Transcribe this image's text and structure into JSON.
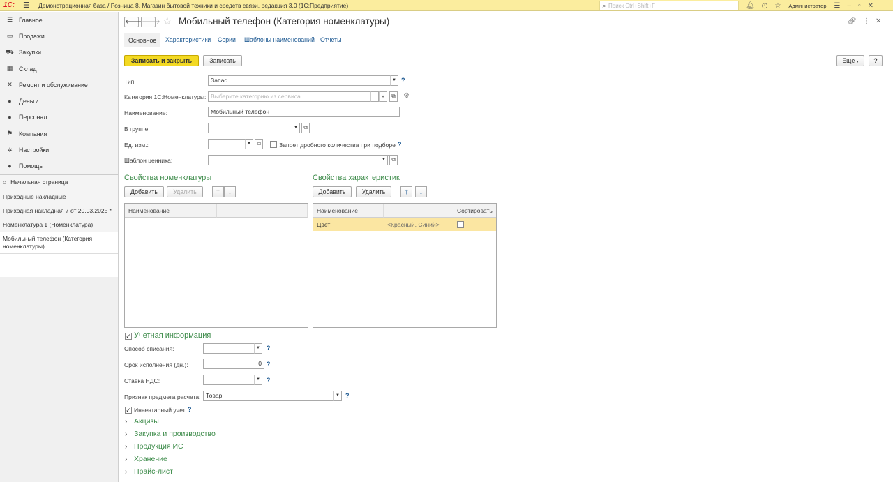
{
  "topbar": {
    "logo": "1С:",
    "title": "Демонстрационная база / Розница 8. Магазин бытовой техники и средств связи, редакция 3.0  (1С:Предприятие)",
    "search_placeholder": "Поиск Ctrl+Shift+F",
    "user": "Администратор"
  },
  "sidebar": {
    "items": [
      {
        "label": "Главное",
        "icon": "menu-icon"
      },
      {
        "label": "Продажи",
        "icon": "sales-icon"
      },
      {
        "label": "Закупки",
        "icon": "purchases-icon"
      },
      {
        "label": "Склад",
        "icon": "warehouse-icon"
      },
      {
        "label": "Ремонт и обслуживание",
        "icon": "repair-icon"
      },
      {
        "label": "Деньги",
        "icon": "money-icon"
      },
      {
        "label": "Персонал",
        "icon": "personnel-icon"
      },
      {
        "label": "Компания",
        "icon": "company-icon"
      },
      {
        "label": "Настройки",
        "icon": "settings-icon"
      },
      {
        "label": "Помощь",
        "icon": "help-icon"
      }
    ],
    "open_windows": {
      "home": "Начальная страница",
      "w1": "Приходные накладные",
      "w2": "Приходная накладная 7 от 20.03.2025 *",
      "w3": "Номенклатура 1 (Номенклатура)",
      "w4": "Мобильный телефон (Категория номенклатуры)"
    }
  },
  "form": {
    "title": "Мобильный телефон (Категория номенклатуры)",
    "tabs": [
      "Основное",
      "Характеристики",
      "Серии",
      "Шаблоны наименований",
      "Отчеты"
    ],
    "buttons": {
      "save_close": "Записать и закрыть",
      "save": "Записать",
      "more": "Еще",
      "help": "?"
    },
    "fields": {
      "type_label": "Тип:",
      "type_value": "Запас",
      "category_label": "Категория 1С:Номенклатуры:",
      "category_placeholder": "Выберите категорию из сервиса",
      "name_label": "Наименование:",
      "name_value": "Мобильный телефон",
      "group_label": "В группе:",
      "group_value": "",
      "unit_label": "Ед. изм.:",
      "unit_value": "",
      "fractional_label": "Запрет дробного количества при подборе",
      "price_tag_label": "Шаблон ценника:",
      "price_tag_value": ""
    },
    "props_item": {
      "title": "Свойства номенклатуры",
      "add": "Добавить",
      "delete": "Удалить",
      "col_name": "Наименование"
    },
    "props_char": {
      "title": "Свойства характеристик",
      "add": "Добавить",
      "delete": "Удалить",
      "col_name": "Наименование",
      "col_sort": "Сортировать",
      "rows": [
        {
          "name": "Цвет",
          "values": "<Красный, Синий>",
          "sort": false
        }
      ]
    },
    "account": {
      "title": "Учетная информация",
      "writeoff_label": "Способ списания:",
      "writeoff_value": "",
      "term_label": "Срок исполнения (дн.):",
      "term_value": "0",
      "vat_label": "Ставка НДС:",
      "vat_value": "",
      "subject_label": "Признак предмета расчета:",
      "subject_value": "Товар",
      "inventory_label": "Инвентарный учет"
    },
    "groups": [
      "Акцизы",
      "Закупка и производство",
      "Продукция ИС",
      "Хранение",
      "Прайс-лист"
    ]
  }
}
